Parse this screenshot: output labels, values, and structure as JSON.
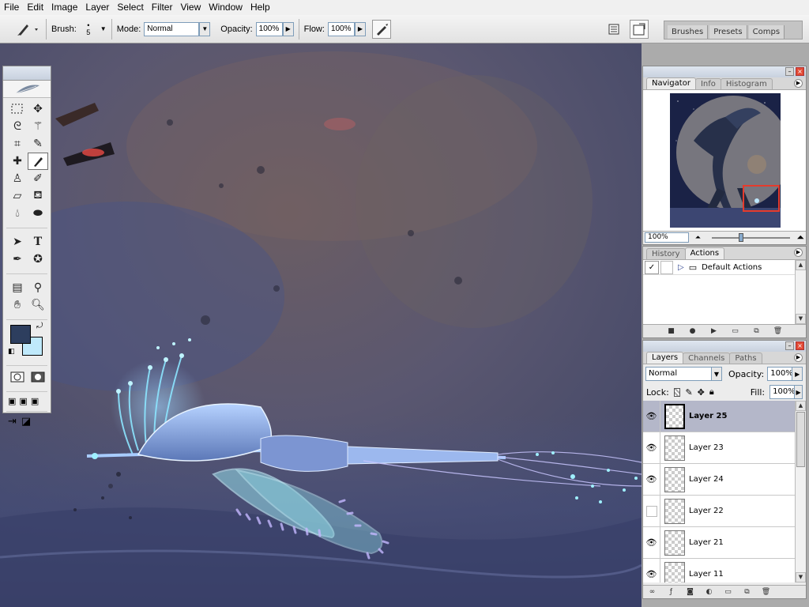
{
  "menu": [
    "File",
    "Edit",
    "Image",
    "Layer",
    "Select",
    "Filter",
    "View",
    "Window",
    "Help"
  ],
  "options": {
    "brush_label": "Brush:",
    "brush_size": "5",
    "mode_label": "Mode:",
    "mode_value": "Normal",
    "opacity_label": "Opacity:",
    "opacity_value": "100%",
    "flow_label": "Flow:",
    "flow_value": "100%"
  },
  "wells": [
    "Brushes",
    "Presets",
    "Comps"
  ],
  "navigator": {
    "tabs": [
      "Navigator",
      "Info",
      "Histogram"
    ],
    "zoom": "100%"
  },
  "history": {
    "tabs": [
      "History",
      "Actions"
    ],
    "action_set": "Default Actions"
  },
  "layers_panel": {
    "tabs": [
      "Layers",
      "Channels",
      "Paths"
    ],
    "blend_mode": "Normal",
    "opacity_label": "Opacity:",
    "opacity_value": "100%",
    "lock_label": "Lock:",
    "fill_label": "Fill:",
    "fill_value": "100%",
    "layers": [
      {
        "name": "Layer 25",
        "visible": true,
        "selected": true
      },
      {
        "name": "Layer 23",
        "visible": true,
        "selected": false
      },
      {
        "name": "Layer 24",
        "visible": true,
        "selected": false
      },
      {
        "name": "Layer 22",
        "visible": false,
        "selected": false
      },
      {
        "name": "Layer 21",
        "visible": true,
        "selected": false
      },
      {
        "name": "Layer 11",
        "visible": true,
        "selected": false
      }
    ]
  },
  "colors": {
    "foreground": "#2d3e5e",
    "background": "#bfe9fb",
    "accent_red": "#e53b2c"
  }
}
